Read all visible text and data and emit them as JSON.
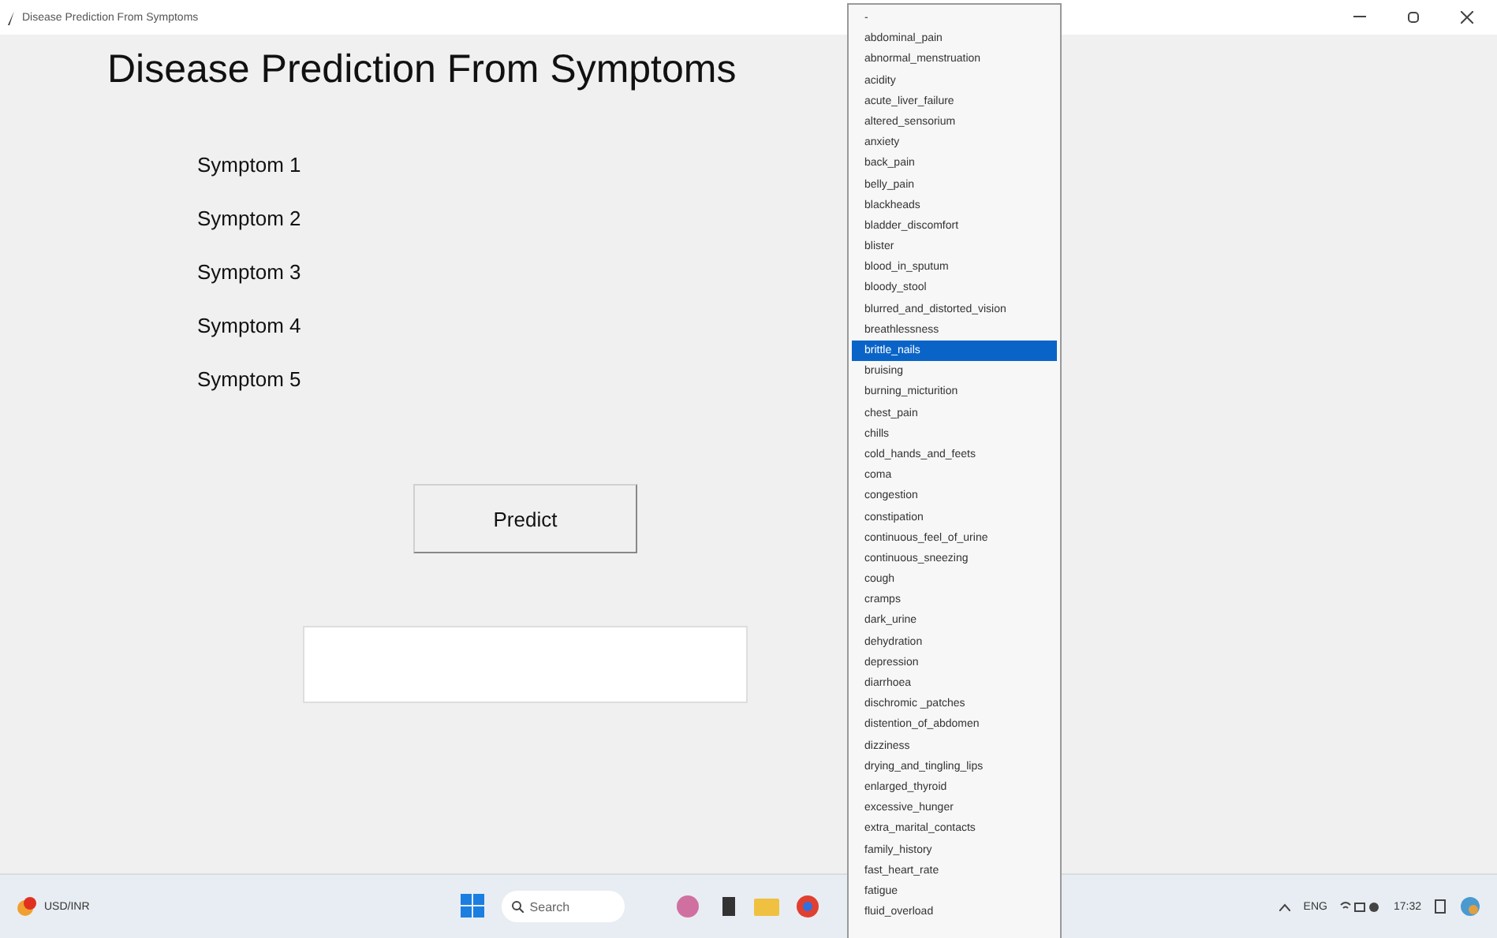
{
  "window": {
    "title": "Disease Prediction From Symptoms"
  },
  "heading": "Disease Prediction From Symptoms",
  "symptoms": [
    {
      "label": "Symptom 1"
    },
    {
      "label": "Symptom 2"
    },
    {
      "label": "Symptom 3"
    },
    {
      "label": "Symptom 4"
    },
    {
      "label": "Symptom 5"
    }
  ],
  "predict_button": "Predict",
  "dropdown": {
    "items": [
      {
        "label": "-",
        "selected": false
      },
      {
        "label": "abdominal_pain",
        "selected": false
      },
      {
        "label": "abnormal_menstruation",
        "selected": false
      },
      {
        "label": "acidity",
        "selected": false
      },
      {
        "label": "acute_liver_failure",
        "selected": false
      },
      {
        "label": "altered_sensorium",
        "selected": false
      },
      {
        "label": "anxiety",
        "selected": false
      },
      {
        "label": "back_pain",
        "selected": false
      },
      {
        "label": "belly_pain",
        "selected": false
      },
      {
        "label": "blackheads",
        "selected": false
      },
      {
        "label": "bladder_discomfort",
        "selected": false
      },
      {
        "label": "blister",
        "selected": false
      },
      {
        "label": "blood_in_sputum",
        "selected": false
      },
      {
        "label": "bloody_stool",
        "selected": false
      },
      {
        "label": "blurred_and_distorted_vision",
        "selected": false
      },
      {
        "label": "breathlessness",
        "selected": false
      },
      {
        "label": "brittle_nails",
        "selected": true
      },
      {
        "label": "bruising",
        "selected": false
      },
      {
        "label": "burning_micturition",
        "selected": false
      },
      {
        "label": "chest_pain",
        "selected": false
      },
      {
        "label": "chills",
        "selected": false
      },
      {
        "label": "cold_hands_and_feets",
        "selected": false
      },
      {
        "label": "coma",
        "selected": false
      },
      {
        "label": "congestion",
        "selected": false
      },
      {
        "label": "constipation",
        "selected": false
      },
      {
        "label": "continuous_feel_of_urine",
        "selected": false
      },
      {
        "label": "continuous_sneezing",
        "selected": false
      },
      {
        "label": "cough",
        "selected": false
      },
      {
        "label": "cramps",
        "selected": false
      },
      {
        "label": "dark_urine",
        "selected": false
      },
      {
        "label": "dehydration",
        "selected": false
      },
      {
        "label": "depression",
        "selected": false
      },
      {
        "label": "diarrhoea",
        "selected": false
      },
      {
        "label": "dischromic _patches",
        "selected": false
      },
      {
        "label": "distention_of_abdomen",
        "selected": false
      },
      {
        "label": "dizziness",
        "selected": false
      },
      {
        "label": "drying_and_tingling_lips",
        "selected": false
      },
      {
        "label": "enlarged_thyroid",
        "selected": false
      },
      {
        "label": "excessive_hunger",
        "selected": false
      },
      {
        "label": "extra_marital_contacts",
        "selected": false
      },
      {
        "label": "family_history",
        "selected": false
      },
      {
        "label": "fast_heart_rate",
        "selected": false
      },
      {
        "label": "fatigue",
        "selected": false
      },
      {
        "label": "fluid_overload",
        "selected": false
      }
    ]
  },
  "taskbar": {
    "widget": "USD/INR",
    "search_placeholder": "Search",
    "language": "ENG",
    "time": "17:32"
  }
}
